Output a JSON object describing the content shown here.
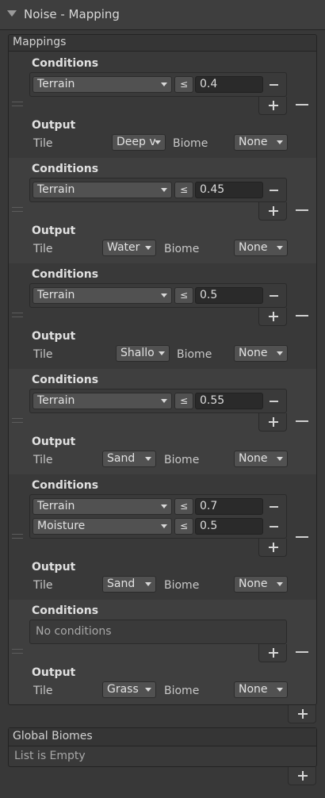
{
  "header": {
    "title": "Noise - Mapping",
    "fold_icon": "foldout-triangle-down-icon"
  },
  "mappings": {
    "label": "Mappings",
    "conditions_label": "Conditions",
    "output_label": "Output",
    "tile_label": "Tile",
    "biome_label": "Biome",
    "no_conditions": "No conditions",
    "entries": [
      {
        "conditions": [
          {
            "source": "Terrain",
            "op": "≤",
            "value": "0.4"
          }
        ],
        "tile": "Deep v",
        "biome": "None"
      },
      {
        "conditions": [
          {
            "source": "Terrain",
            "op": "≤",
            "value": "0.45"
          }
        ],
        "tile": "Water",
        "biome": "None"
      },
      {
        "conditions": [
          {
            "source": "Terrain",
            "op": "≤",
            "value": "0.5"
          }
        ],
        "tile": "Shallo",
        "biome": "None"
      },
      {
        "conditions": [
          {
            "source": "Terrain",
            "op": "≤",
            "value": "0.55"
          }
        ],
        "tile": "Sand",
        "biome": "None"
      },
      {
        "conditions": [
          {
            "source": "Terrain",
            "op": "≤",
            "value": "0.7"
          },
          {
            "source": "Moisture",
            "op": "≤",
            "value": "0.5"
          }
        ],
        "tile": "Sand",
        "biome": "None"
      },
      {
        "conditions": [],
        "tile": "Grass",
        "biome": "None"
      }
    ]
  },
  "global_biomes": {
    "label": "Global Biomes",
    "empty_text": "List is Empty"
  }
}
